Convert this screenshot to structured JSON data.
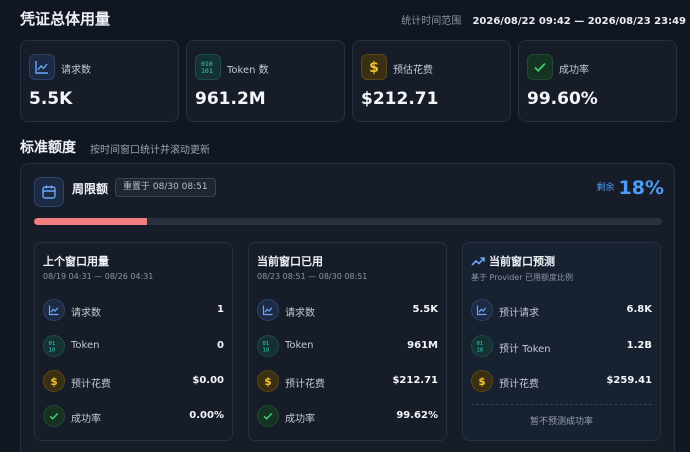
{
  "header": {
    "title": "凭证总体用量",
    "range_label": "统计时间范围",
    "range_value": "2026/08/22 09:42 — 2026/08/23 23:49"
  },
  "stats": [
    {
      "label": "请求数",
      "value": "5.5K",
      "icon": "chart-line-icon"
    },
    {
      "label": "Token 数",
      "value": "961.2M",
      "icon": "binary-icon"
    },
    {
      "label": "预估花费",
      "value": "$212.71",
      "icon": "dollar-icon"
    },
    {
      "label": "成功率",
      "value": "99.60%",
      "icon": "check-icon"
    }
  ],
  "section": {
    "title": "标准额度",
    "subtitle": "按时间窗口统计并滚动更新"
  },
  "quota": {
    "title": "周限额",
    "reset": "重置于 08/30 08:51",
    "remaining_label": "剩余",
    "remaining_value": "18%",
    "used_fraction": 0.18,
    "icon": "calendar-icon"
  },
  "windows": [
    {
      "title": "上个窗口用量",
      "subtitle": "08/19 04:31 — 08/26 04:31",
      "rows": [
        {
          "label": "请求数",
          "value": "1"
        },
        {
          "label": "Token",
          "value": "0"
        },
        {
          "label": "预计花费",
          "value": "$0.00"
        },
        {
          "label": "成功率",
          "value": "0.00%"
        }
      ]
    },
    {
      "title": "当前窗口已用",
      "subtitle": "08/23 08:51 — 08/30 08:51",
      "rows": [
        {
          "label": "请求数",
          "value": "5.5K"
        },
        {
          "label": "Token",
          "value": "961M"
        },
        {
          "label": "预计花费",
          "value": "$212.71"
        },
        {
          "label": "成功率",
          "value": "99.62%"
        }
      ]
    },
    {
      "title": "当前窗口预测",
      "subtitle": "基于 Provider 已用额度比例",
      "rows": [
        {
          "label": "预计请求",
          "value": "6.8K"
        },
        {
          "label": "预计 Token",
          "value": "1.2B"
        },
        {
          "label": "预计花费",
          "value": "$259.41"
        }
      ],
      "note": "暂不预测成功率"
    }
  ],
  "colors": {
    "background": "#111722",
    "accent": "#4d9bf4",
    "bar_fill": "#f07e7e",
    "success": "#3ecf6e",
    "gold": "#f2c230"
  }
}
